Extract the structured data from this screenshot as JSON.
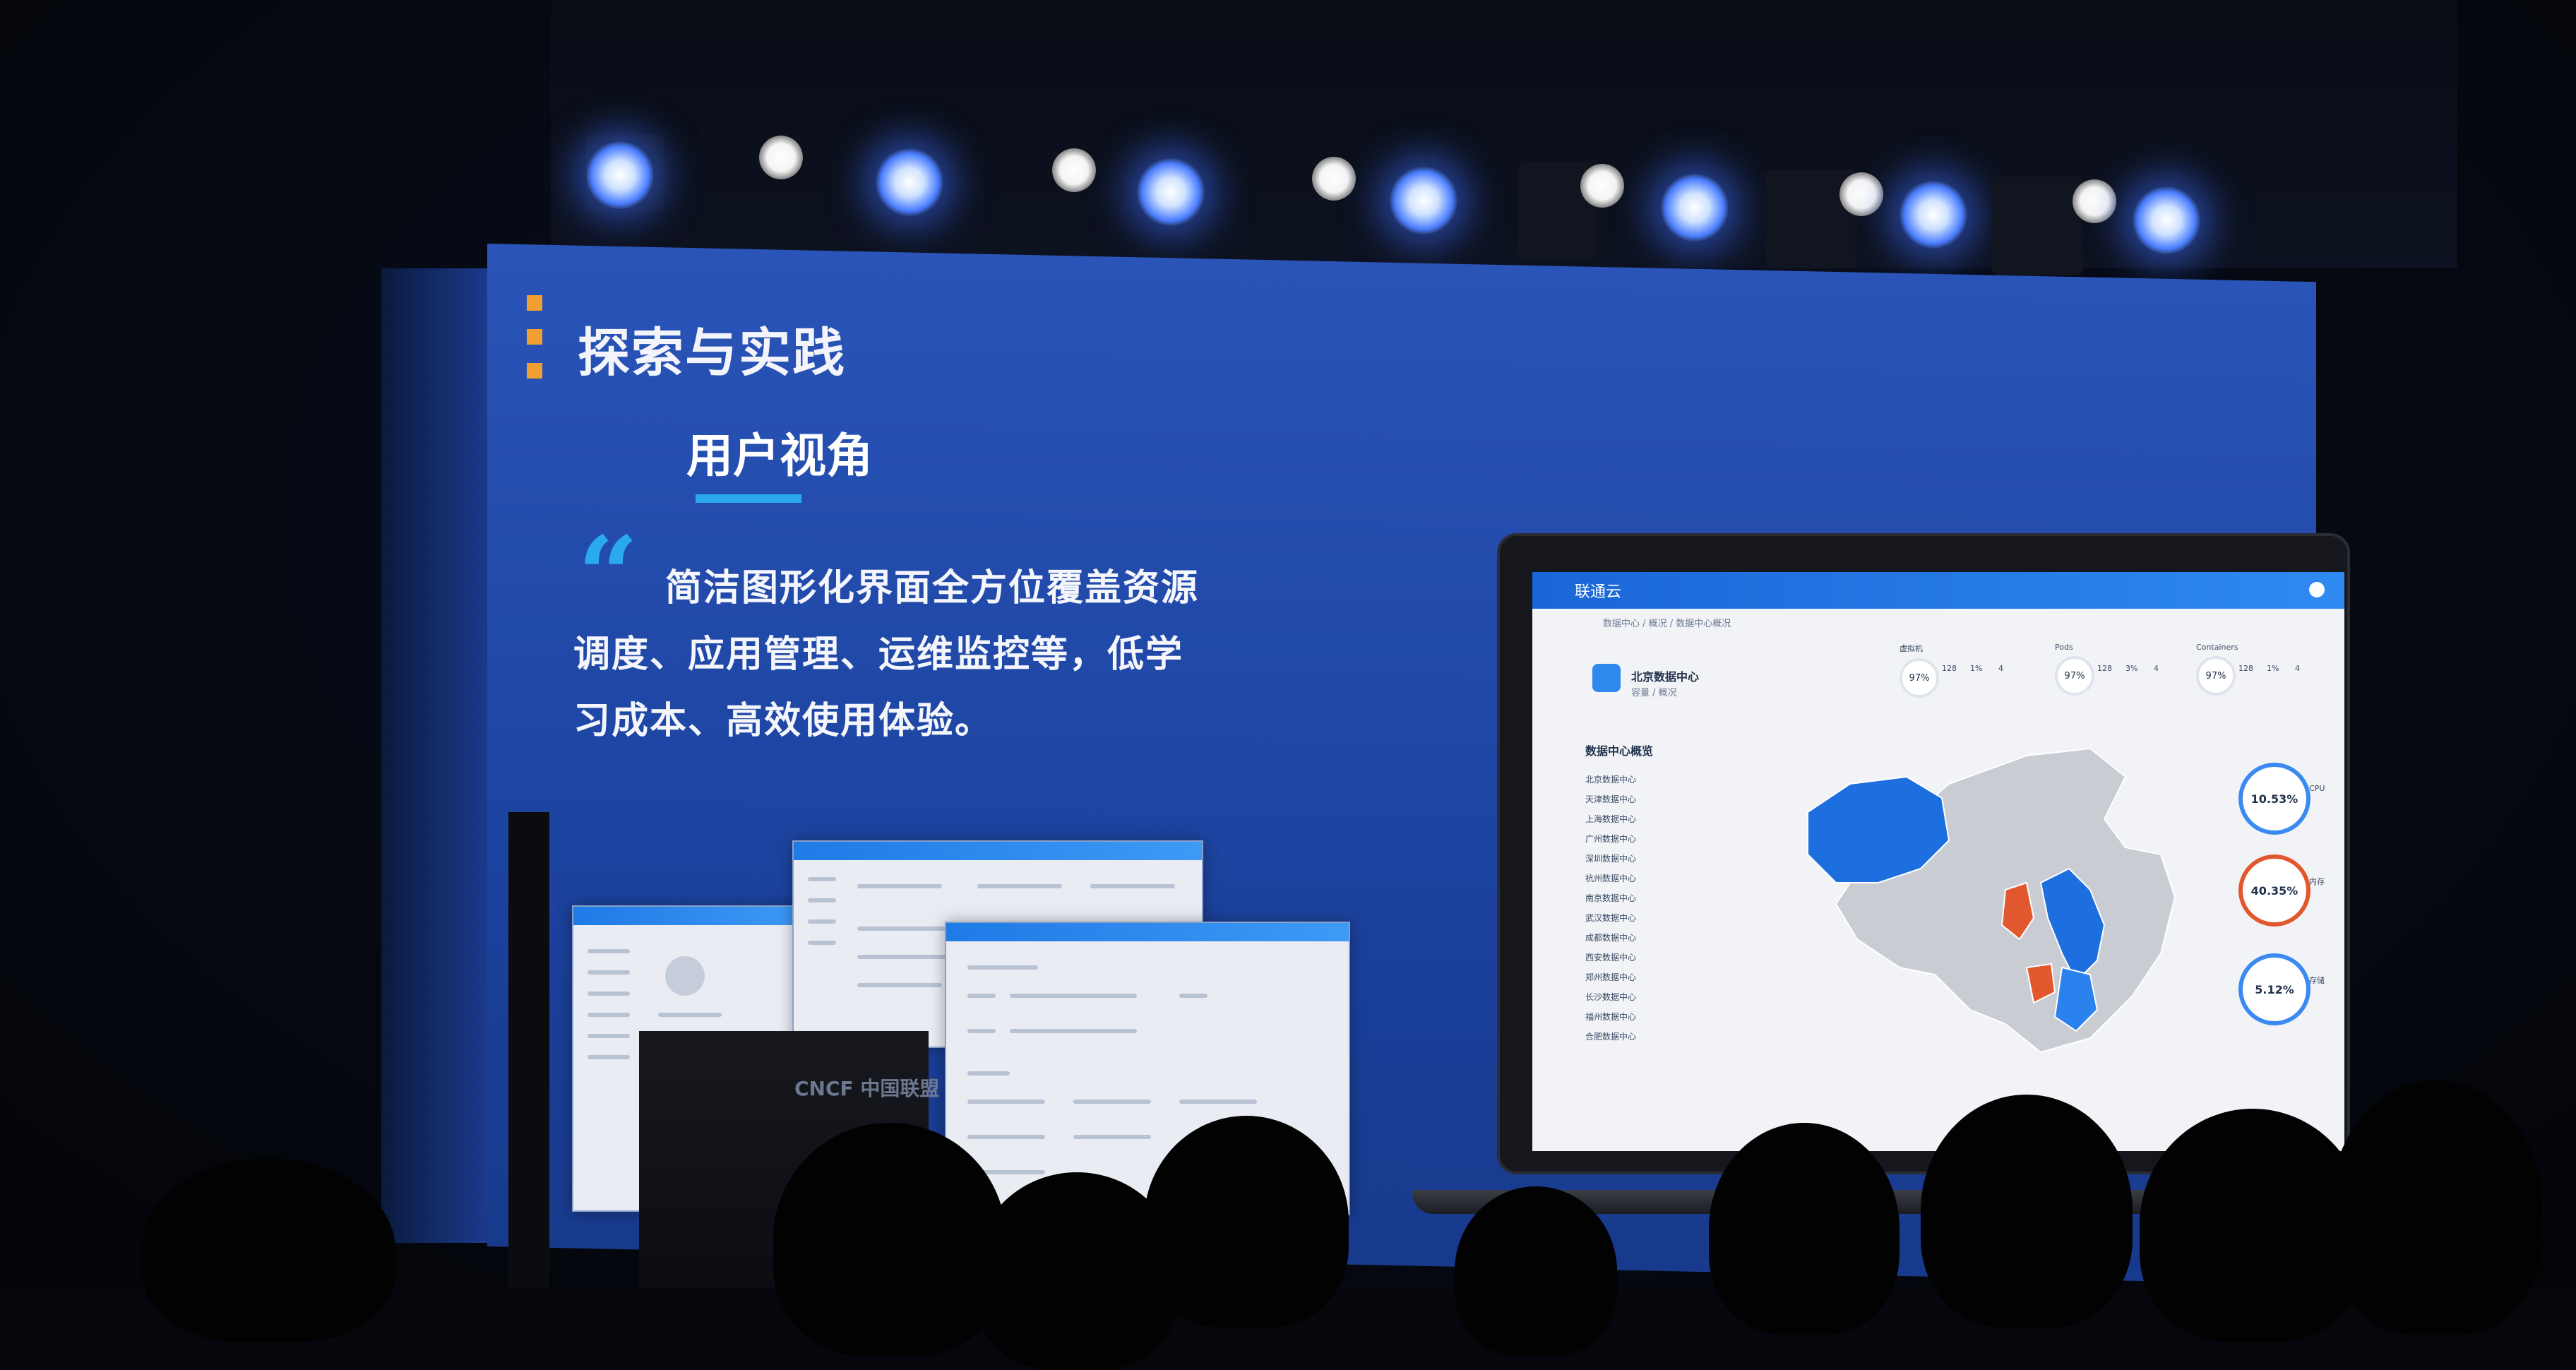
{
  "slide": {
    "title": "探索与实践",
    "subtitle": "用户视角",
    "quote_mark": "“",
    "body_lines": [
      "简洁图形化界面全方位覆盖资源",
      "调度、应用管理、运维监控等，低学",
      "习成本、高效使用体验。"
    ],
    "accent_color": "#2aa9f0",
    "bullet_color": "#f0a030",
    "background_color": "#2049a8"
  },
  "podium": {
    "logo_text": "CNCF 中国联盟"
  },
  "laptop_ui": {
    "brand": "联通云",
    "header_color": "#1a66d8",
    "breadcrumb": "数据中心 / 概况 / 数据中心概况",
    "datacenter": {
      "name": "北京数据中心",
      "sub": "容量 / 概况"
    },
    "section_title": "数据中心概览",
    "stat_groups": [
      {
        "label": "虚拟机",
        "percent": "97%",
        "count_a": "128",
        "count_b": "1%",
        "count_c": "4"
      },
      {
        "label": "Pods",
        "percent": "97%",
        "count_a": "128",
        "count_b": "3%",
        "count_c": "4"
      },
      {
        "label": "Containers",
        "percent": "97%",
        "count_a": "128",
        "count_b": "1%",
        "count_c": "4"
      }
    ],
    "list_items": [
      "北京数据中心",
      "天津数据中心",
      "上海数据中心",
      "广州数据中心",
      "深圳数据中心",
      "杭州数据中心",
      "南京数据中心",
      "武汉数据中心",
      "成都数据中心",
      "西安数据中心",
      "郑州数据中心",
      "长沙数据中心",
      "福州数据中心",
      "合肥数据中心"
    ],
    "right_rings": [
      {
        "value": "10.53%",
        "label": "CPU"
      },
      {
        "value": "40.35%",
        "label": "内存"
      },
      {
        "value": "5.12%",
        "label": "存储"
      }
    ],
    "map_colors": {
      "highlight_blue": "#1d6fe0",
      "highlight_red": "#e2582e",
      "base_gray": "#c9ccd3"
    }
  }
}
